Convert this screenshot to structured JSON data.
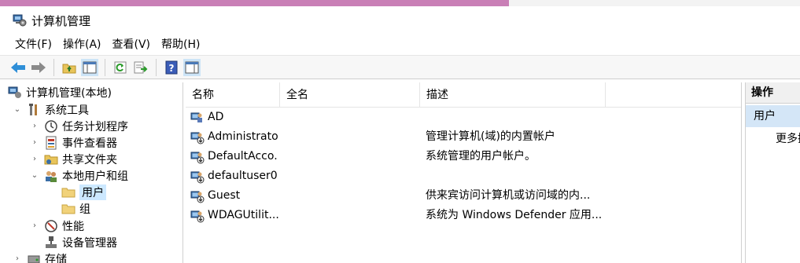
{
  "window": {
    "title": "计算机管理"
  },
  "menu": [
    "文件(F)",
    "操作(A)",
    "查看(V)",
    "帮助(H)"
  ],
  "toolbar": {
    "buttons": [
      "back-icon",
      "forward-icon",
      "up-folder-icon",
      "show-hide-tree-icon",
      "refresh-icon",
      "export-list-icon",
      "help-icon",
      "show-action-pane-icon"
    ]
  },
  "tree": {
    "items": [
      {
        "label": "计算机管理(本地)",
        "icon": "computer-management-icon"
      },
      {
        "label": "系统工具",
        "icon": "tools-icon",
        "expanded": true
      },
      {
        "label": "任务计划程序",
        "icon": "clock-icon"
      },
      {
        "label": "事件查看器",
        "icon": "event-viewer-icon"
      },
      {
        "label": "共享文件夹",
        "icon": "shared-folder-icon"
      },
      {
        "label": "本地用户和组",
        "icon": "users-group-icon",
        "expanded": true
      },
      {
        "label": "用户",
        "icon": "folder-icon",
        "selected": true
      },
      {
        "label": "组",
        "icon": "folder-icon"
      },
      {
        "label": "性能",
        "icon": "performance-icon"
      },
      {
        "label": "设备管理器",
        "icon": "device-manager-icon"
      },
      {
        "label": "存储",
        "icon": "storage-icon"
      }
    ]
  },
  "list": {
    "columns": [
      "名称",
      "全名",
      "描述"
    ],
    "rows": [
      {
        "name": "AD",
        "fullname": "",
        "description": "",
        "disabled": false
      },
      {
        "name": "Administrator",
        "fullname": "",
        "description": "管理计算机(域)的内置帐户",
        "disabled": true
      },
      {
        "name": "DefaultAcco...",
        "fullname": "",
        "description": "系统管理的用户帐户。",
        "disabled": true
      },
      {
        "name": "defaultuser0",
        "fullname": "",
        "description": "",
        "disabled": true
      },
      {
        "name": "Guest",
        "fullname": "",
        "description": "供来宾访问计算机或访问域的内...",
        "disabled": true
      },
      {
        "name": "WDAGUtilit...",
        "fullname": "",
        "description": "系统为 Windows Defender 应用...",
        "disabled": true
      }
    ]
  },
  "actions": {
    "title": "操作",
    "section": "用户",
    "more": "更多操作"
  }
}
